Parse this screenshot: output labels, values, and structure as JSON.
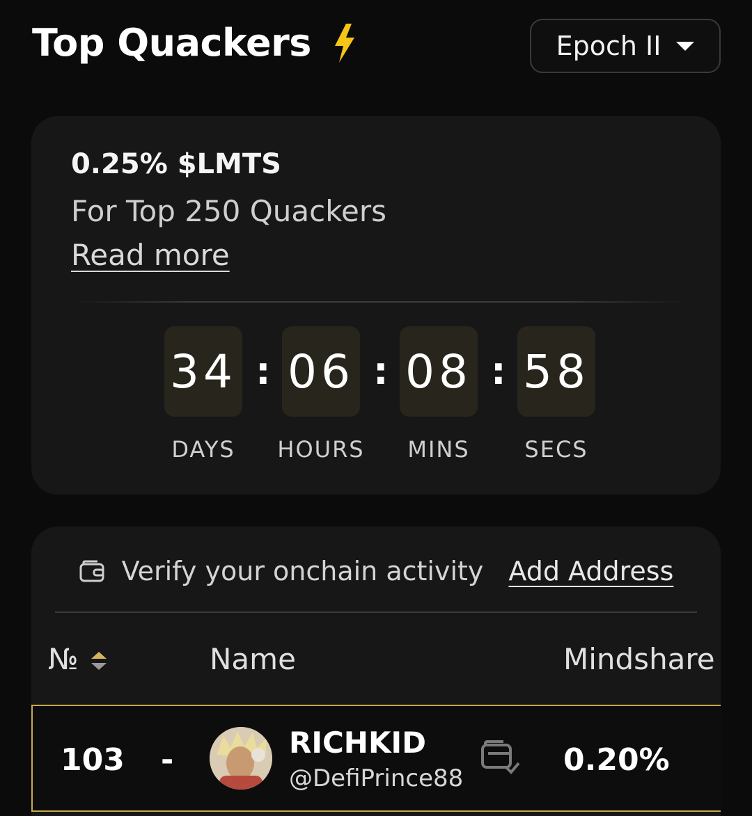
{
  "header": {
    "title": "Top Quackers",
    "epoch_selected": "Epoch II"
  },
  "reward": {
    "amount": "0.25% $LMTS",
    "subtitle": "For Top 250 Quackers",
    "read_more": "Read more"
  },
  "countdown": {
    "days": "34",
    "hours": "06",
    "mins": "08",
    "secs": "58",
    "separator": ":",
    "labels": {
      "days": "DAYS",
      "hours": "HOURS",
      "mins": "MINS",
      "secs": "SECS"
    }
  },
  "verify": {
    "text": "Verify your onchain activity",
    "link": "Add Address"
  },
  "table": {
    "headers": {
      "rank": "№",
      "name": "Name",
      "mindshare": "Mindshare"
    },
    "rows": [
      {
        "rank": "103",
        "change": "-",
        "name": "RICHKID",
        "handle": "@DefiPrince88",
        "mindshare": "0.20%"
      }
    ]
  },
  "colors": {
    "background": "#0b0b0b",
    "card": "#171717",
    "accent_gold": "#c9a94c",
    "bolt": "#f5c518",
    "countdown_box": "#27251c"
  },
  "icons": [
    "lightning-bolt-icon",
    "chevron-down-icon",
    "wallet-icon",
    "sort-icon",
    "verified-wallet-icon"
  ]
}
